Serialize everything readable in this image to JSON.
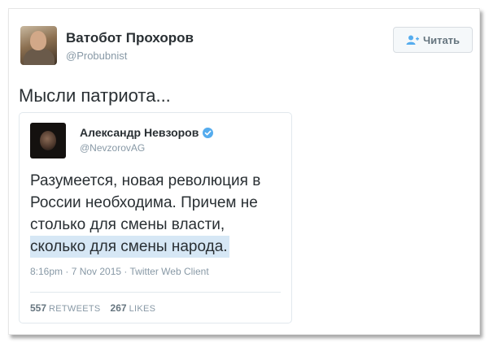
{
  "tweet": {
    "author_name": "Ватобот Прохоров",
    "author_handle": "@Probubnist",
    "follow_label": "Читать",
    "text": "Мысли патриота..."
  },
  "quoted": {
    "author_name": "Александр Невзоров",
    "author_handle": "@NevzorovAG",
    "lines": [
      "Разумеется, новая революция в",
      "России необходима. Причем не",
      "столько для смены власти,",
      "сколько для смены народа."
    ],
    "meta": "8:16pm · 7 Nov 2015 · Twitter Web Client",
    "retweets_count": "557",
    "retweets_label": "RETWEETS",
    "likes_count": "267",
    "likes_label": "LIKES"
  },
  "icons": {
    "follow": "add-person-icon",
    "verified": "verified-badge-icon"
  },
  "colors": {
    "text": "#292f33",
    "muted": "#8899a6",
    "verified": "#55acee",
    "highlight": "#d6e7f5"
  }
}
